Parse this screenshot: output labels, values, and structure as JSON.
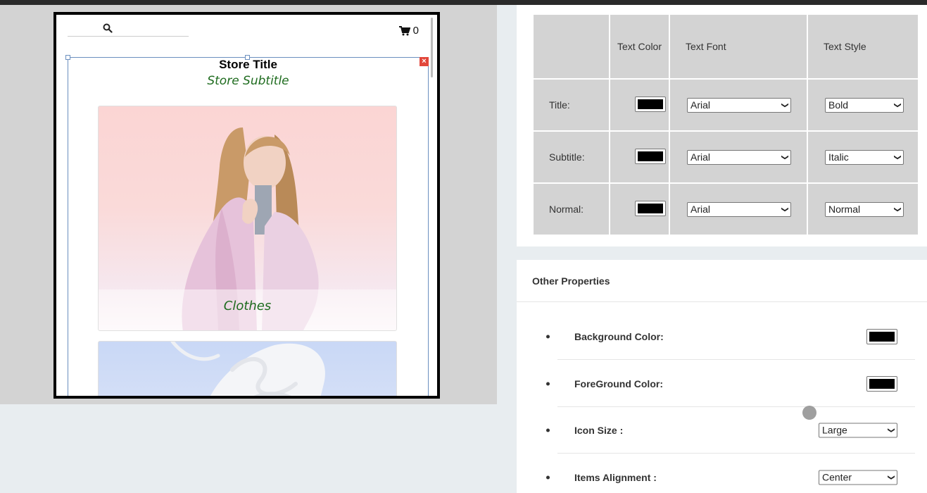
{
  "preview": {
    "cart_count": "0",
    "store_title": "Store Title",
    "store_subtitle": "Store Subtitle",
    "close_glyph": "×",
    "categories": [
      {
        "label": "Clothes"
      },
      {
        "label": ""
      }
    ]
  },
  "text_styles": {
    "headers": [
      "",
      "Text Color",
      "Text Font",
      "Text Style"
    ],
    "rows": [
      {
        "label": "Title:",
        "color": "#000000",
        "font": "Arial",
        "style": "Bold"
      },
      {
        "label": "Subtitle:",
        "color": "#000000",
        "font": "Arial",
        "style": "Italic"
      },
      {
        "label": "Normal:",
        "color": "#000000",
        "font": "Arial",
        "style": "Normal"
      }
    ]
  },
  "other_properties": {
    "title": "Other Properties",
    "items": [
      {
        "label": "Background Color:",
        "type": "color",
        "value": "#000000"
      },
      {
        "label": "ForeGround Color:",
        "type": "color",
        "value": "#000000"
      },
      {
        "label": "Icon Size :",
        "type": "select",
        "value": "Large"
      },
      {
        "label": "Items Alignment :",
        "type": "select",
        "value": "Center"
      }
    ]
  },
  "icons": {
    "search": "search-icon",
    "cart": "shopping-cart-icon",
    "close": "close-icon",
    "dropdown": "chevron-down-icon"
  },
  "colors": {
    "accent_green": "#1e6b1e",
    "selection_border": "#6b8fbf",
    "close_red": "#e2473b"
  }
}
